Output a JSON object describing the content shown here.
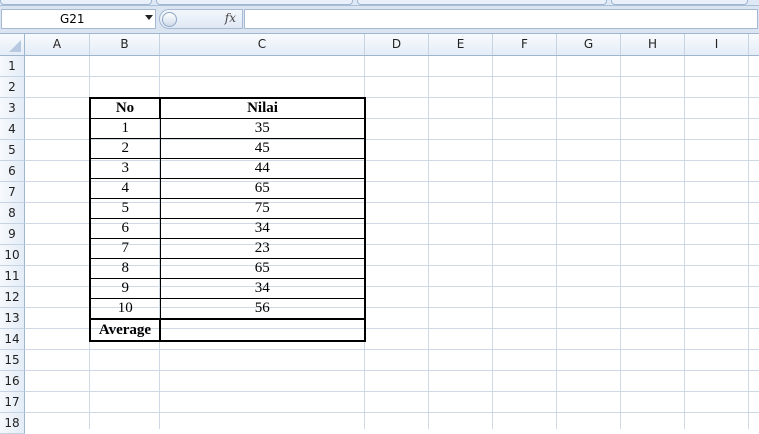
{
  "formula_bar": {
    "name_box": "G21",
    "fx_label": "fx",
    "formula": ""
  },
  "columns": [
    "A",
    "B",
    "C",
    "D",
    "E",
    "F",
    "G",
    "H",
    "I"
  ],
  "rows": [
    "1",
    "2",
    "3",
    "4",
    "5",
    "6",
    "7",
    "8",
    "9",
    "10",
    "11",
    "12",
    "13",
    "14",
    "15",
    "16",
    "17",
    "18"
  ],
  "table": {
    "header_no": "No",
    "header_nilai": "Nilai",
    "entries": [
      {
        "no": "1",
        "nilai": "35"
      },
      {
        "no": "2",
        "nilai": "45"
      },
      {
        "no": "3",
        "nilai": "44"
      },
      {
        "no": "4",
        "nilai": "65"
      },
      {
        "no": "5",
        "nilai": "75"
      },
      {
        "no": "6",
        "nilai": "34"
      },
      {
        "no": "7",
        "nilai": "23"
      },
      {
        "no": "8",
        "nilai": "65"
      },
      {
        "no": "9",
        "nilai": "34"
      },
      {
        "no": "10",
        "nilai": "56"
      }
    ],
    "footer_label": "Average",
    "footer_value": ""
  },
  "colors": {
    "header_bg": "#e4ecf7",
    "gridline": "#d0d7e5",
    "table_border": "#000000"
  }
}
